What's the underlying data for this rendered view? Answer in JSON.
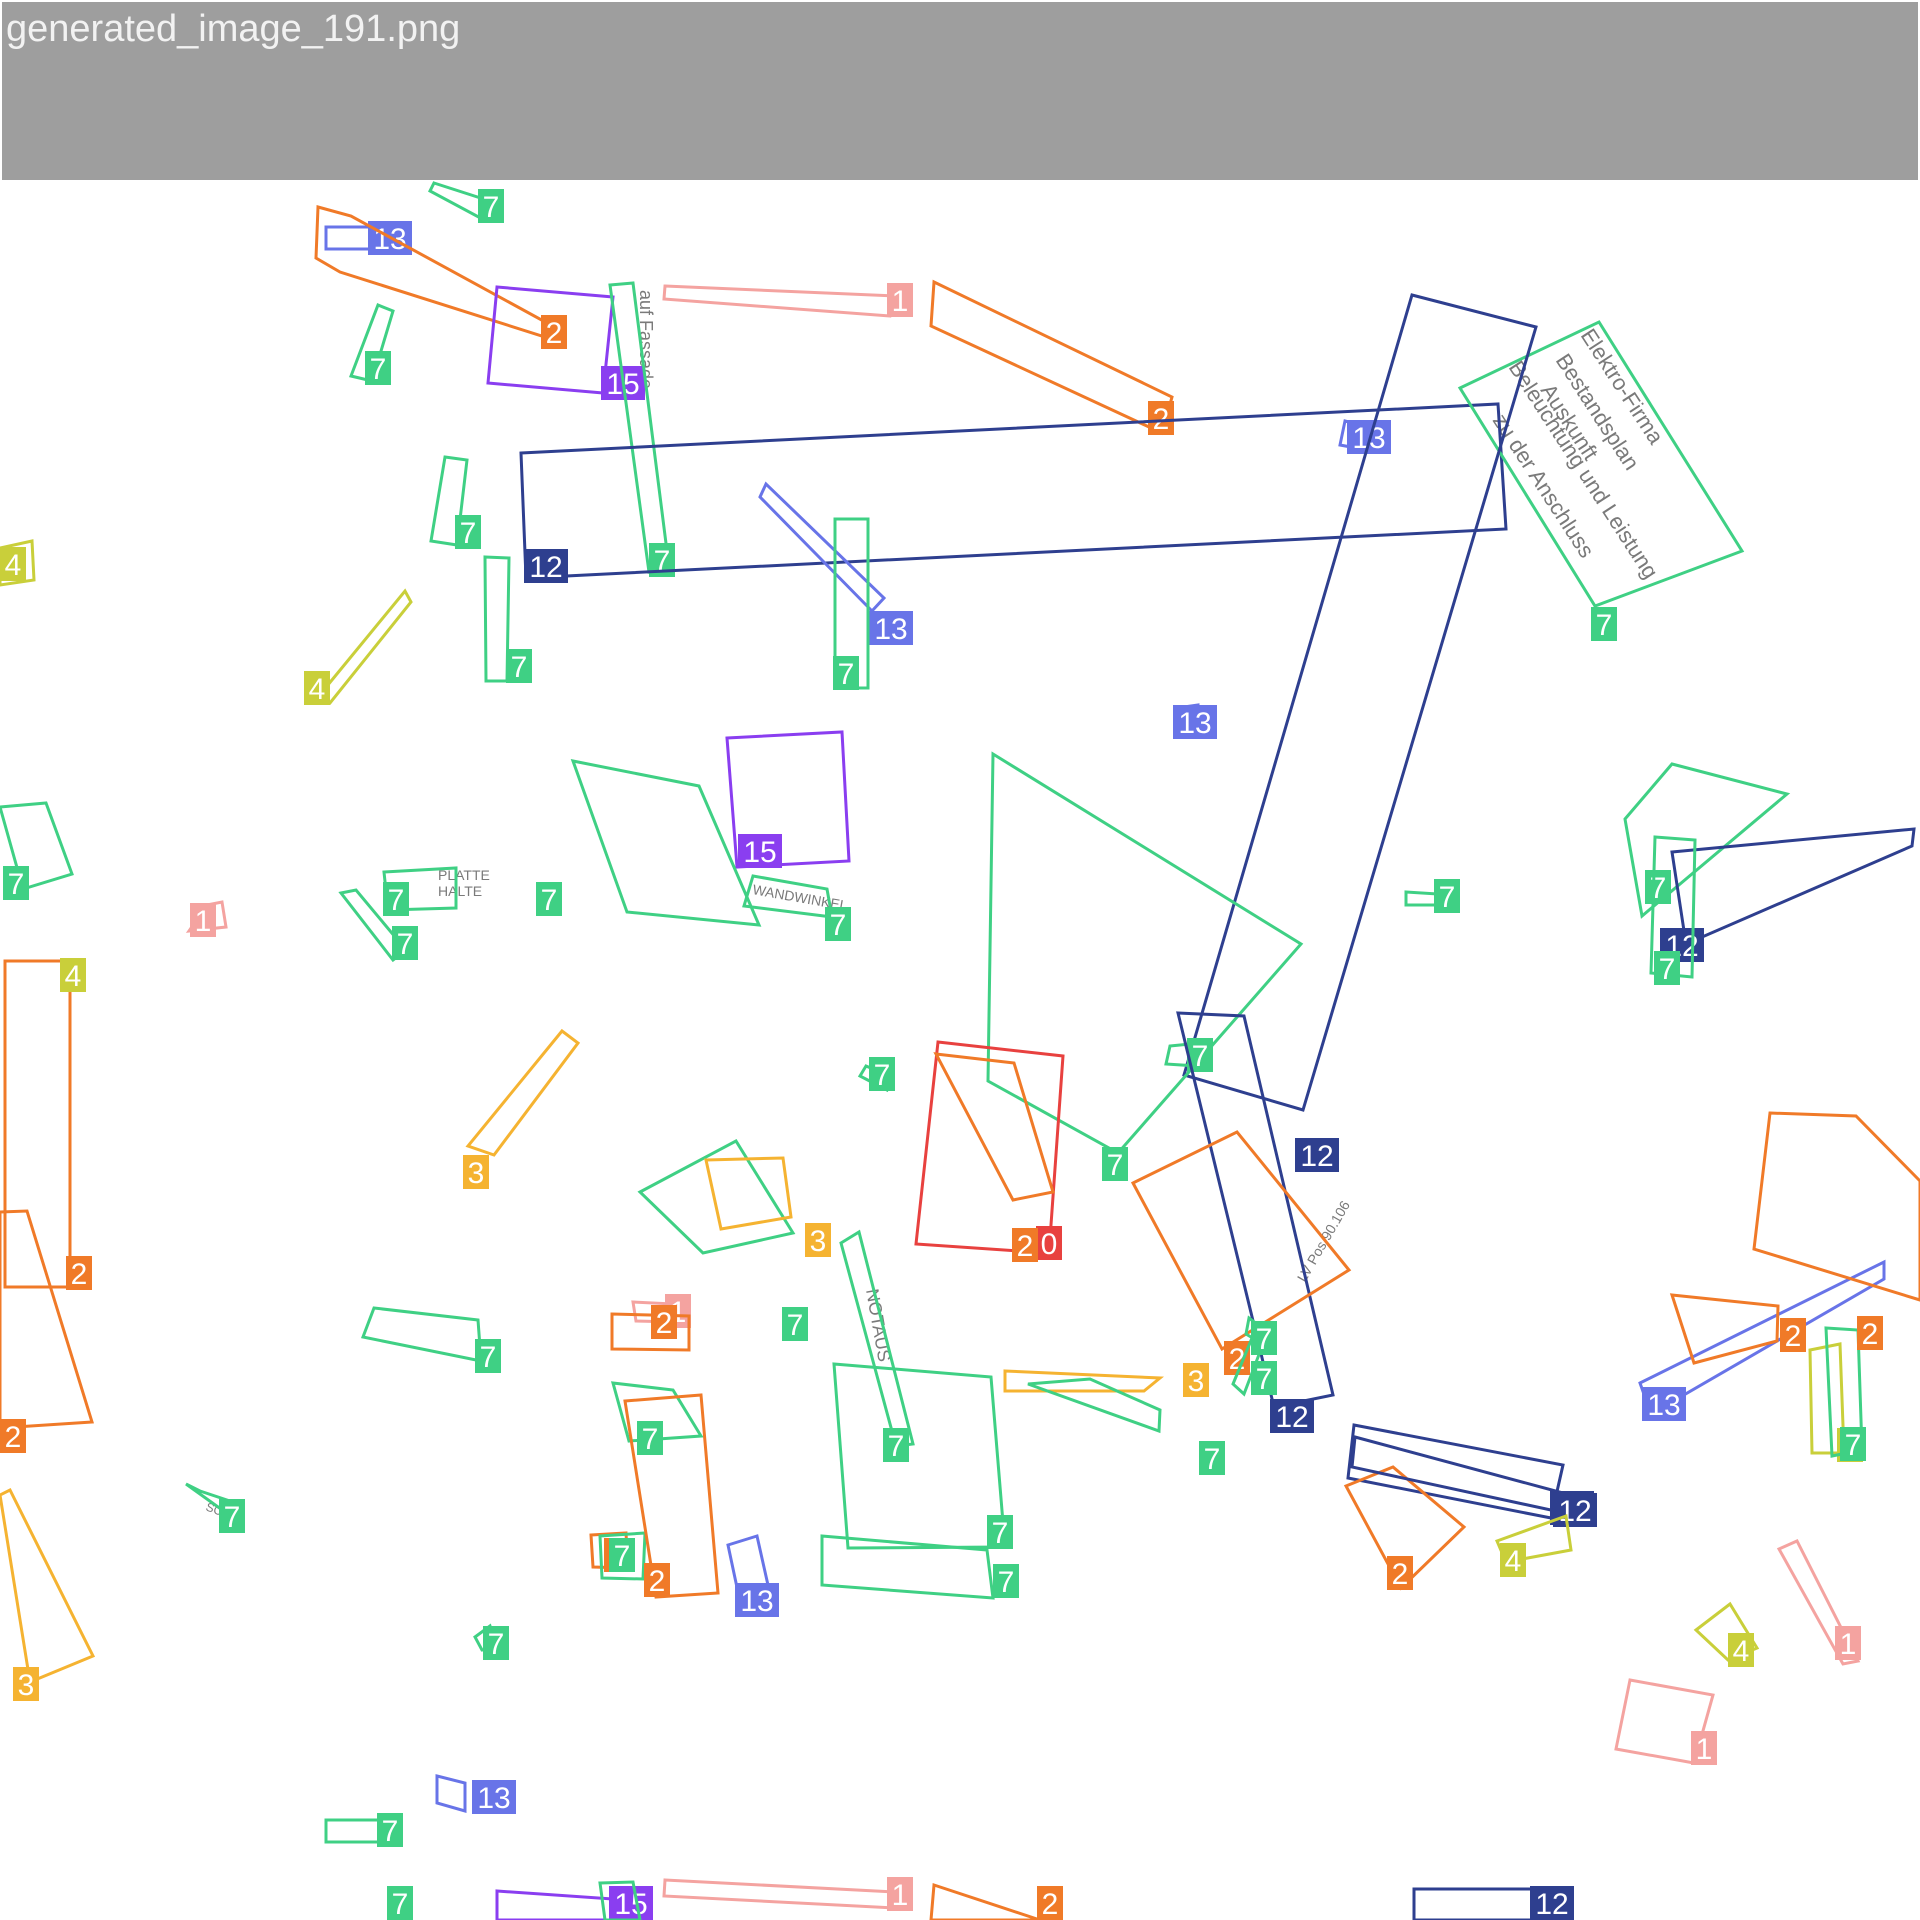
{
  "window": {
    "title": "generated_image_191.png"
  },
  "palette": {
    "0": "#e8413f",
    "1": "#f4a3a0",
    "2": "#f07a28",
    "3": "#f5b331",
    "4": "#c9cf3a",
    "7": "#3fd084",
    "12": "#2e3f8f",
    "13": "#6874e8",
    "15": "#8a3ef0"
  },
  "annotations": [
    {
      "label": "13"
    },
    {
      "label": "2"
    },
    {
      "label": "7"
    },
    {
      "label": "15"
    },
    {
      "label": "1"
    },
    {
      "label": "2"
    },
    {
      "label": "7"
    },
    {
      "label": "7"
    },
    {
      "label": "12"
    },
    {
      "label": "13"
    },
    {
      "label": "7"
    },
    {
      "label": "7"
    },
    {
      "label": "13"
    },
    {
      "label": "7"
    },
    {
      "label": "7"
    },
    {
      "label": "4"
    },
    {
      "label": "4"
    },
    {
      "label": "13"
    },
    {
      "label": "15"
    },
    {
      "label": "7"
    },
    {
      "label": "12"
    },
    {
      "label": "7"
    },
    {
      "label": "7"
    },
    {
      "label": "7"
    },
    {
      "label": "1"
    },
    {
      "label": "7"
    },
    {
      "label": "7"
    },
    {
      "label": "7"
    },
    {
      "label": "7"
    },
    {
      "label": "0"
    },
    {
      "label": "12"
    },
    {
      "label": "7"
    },
    {
      "label": "7"
    },
    {
      "label": "12"
    },
    {
      "label": "7"
    },
    {
      "label": "3"
    },
    {
      "label": "2"
    },
    {
      "label": "4"
    },
    {
      "label": "2"
    },
    {
      "label": "2"
    },
    {
      "label": "7"
    },
    {
      "label": "7"
    },
    {
      "label": "3"
    },
    {
      "label": "7"
    },
    {
      "label": "7"
    },
    {
      "label": "1"
    },
    {
      "label": "2"
    },
    {
      "label": "7"
    },
    {
      "label": "3"
    },
    {
      "label": "7"
    },
    {
      "label": "12"
    },
    {
      "label": "7"
    },
    {
      "label": "7"
    },
    {
      "label": "2"
    },
    {
      "label": "13"
    },
    {
      "label": "2"
    },
    {
      "label": "4"
    },
    {
      "label": "7"
    },
    {
      "label": "2"
    },
    {
      "label": "12"
    },
    {
      "label": "2"
    },
    {
      "label": "4"
    },
    {
      "label": "7"
    },
    {
      "label": "4"
    },
    {
      "label": "1"
    },
    {
      "label": "1"
    },
    {
      "label": "3"
    },
    {
      "label": "2"
    },
    {
      "label": "13"
    },
    {
      "label": "7"
    },
    {
      "label": "2"
    },
    {
      "label": "7"
    },
    {
      "label": "7"
    },
    {
      "label": "13"
    },
    {
      "label": "7"
    },
    {
      "label": "15"
    },
    {
      "label": "1"
    },
    {
      "label": "2"
    },
    {
      "label": "12"
    },
    {
      "label": "7"
    }
  ],
  "document_texts": [
    {
      "text": "Elektro-Firma"
    },
    {
      "text": "Beleuchtung und Leistung"
    },
    {
      "text": "Auskunft"
    },
    {
      "text": "zu der Anschluss"
    },
    {
      "text": "Bestandsplan"
    },
    {
      "text": "PLATTE"
    },
    {
      "text": "HALTE"
    },
    {
      "text": "WANDWINKEL"
    },
    {
      "text": "LV Pos 90.106"
    },
    {
      "text": "NOTAUS"
    },
    {
      "text": "SCHS"
    },
    {
      "text": "auf Fassade"
    }
  ]
}
